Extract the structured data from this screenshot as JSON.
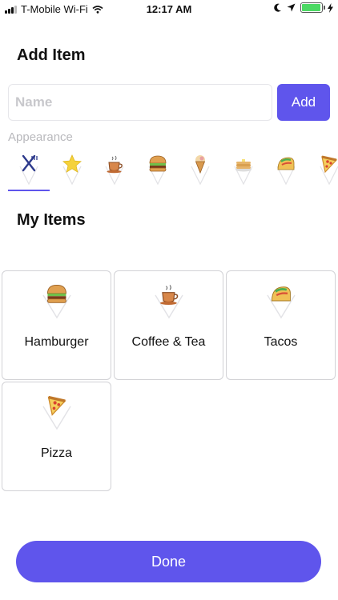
{
  "status_bar": {
    "carrier": "T-Mobile Wi-Fi",
    "time": "12:17 AM",
    "battery_level": 0.95,
    "icons": [
      "signal-icon",
      "wifi-icon",
      "moon-icon",
      "location-icon",
      "battery-icon",
      "charging-icon"
    ]
  },
  "add_item": {
    "title": "Add Item",
    "name_placeholder": "Name",
    "name_value": "",
    "add_label": "Add",
    "appearance_label": "Appearance",
    "icons": [
      "utensils-icon",
      "star-icon",
      "coffee-icon",
      "hamburger-icon",
      "ice-cream-icon",
      "pancakes-icon",
      "taco-icon",
      "pizza-icon"
    ],
    "selected_index": 0
  },
  "my_items": {
    "title": "My Items",
    "items": [
      {
        "label": "Hamburger",
        "icon": "hamburger-icon"
      },
      {
        "label": "Coffee & Tea",
        "icon": "coffee-icon"
      },
      {
        "label": "Tacos",
        "icon": "taco-icon"
      },
      {
        "label": "Pizza",
        "icon": "pizza-icon"
      }
    ]
  },
  "done_label": "Done",
  "colors": {
    "accent": "#5f55ec",
    "battery": "#4cd964",
    "card_border": "#d2d2d6",
    "muted_text": "#b9b9bd"
  }
}
